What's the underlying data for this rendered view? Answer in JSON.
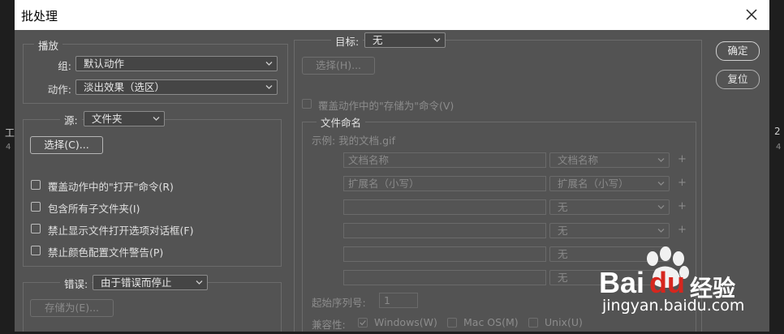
{
  "background": {
    "left_text": "工",
    "left_sub": "4",
    "right_text": "2",
    "right_sub": "4"
  },
  "dialog": {
    "title": "批处理",
    "close_icon": "close-icon"
  },
  "play": {
    "legend": "播放",
    "set_label": "组:",
    "set_value": "默认动作",
    "action_label": "动作:",
    "action_value": "淡出效果（选区）"
  },
  "source": {
    "label": "源:",
    "value": "文件夹",
    "choose_button": "选择(C)...",
    "options": [
      "覆盖动作中的\"打开\"命令(R)",
      "包含所有子文件夹(I)",
      "禁止显示文件打开选项对话框(F)",
      "禁止颜色配置文件警告(P)"
    ]
  },
  "errors": {
    "label": "错误:",
    "value": "由于错误而停止",
    "save_as_button": "存储为(E)..."
  },
  "destination": {
    "label": "目标:",
    "value": "无",
    "choose_button": "选择(H)...",
    "override_save": "覆盖动作中的\"存储为\"命令(V)"
  },
  "file_naming": {
    "legend": "文件命名",
    "example": "示例: 我的文档.gif",
    "rows": [
      {
        "field": "文档名称",
        "select": "文档名称",
        "plus": "+"
      },
      {
        "field": "扩展名（小写）",
        "select": "扩展名（小写）",
        "plus": "+"
      },
      {
        "field": "",
        "select": "无",
        "plus": "+"
      },
      {
        "field": "",
        "select": "无",
        "plus": "+"
      },
      {
        "field": "",
        "select": "无",
        "plus": ""
      },
      {
        "field": "",
        "select": "无",
        "plus": ""
      }
    ],
    "start_serial_label": "起始序列号:",
    "start_serial_value": "1",
    "compat_label": "兼容性:",
    "compat_windows": "Windows(W)",
    "compat_mac": "Mac OS(M)",
    "compat_unix": "Unix(U)"
  },
  "buttons": {
    "ok": "确定",
    "reset": "复位"
  },
  "watermark": {
    "brand_bai": "Bai",
    "brand_du": "du",
    "brand_cn": "经验",
    "url": "jingyan.baidu.com"
  },
  "colors": {
    "dialog_bg": "#535353",
    "titlebar_bg": "#ffffff",
    "watermark_red": "#d7261e"
  }
}
